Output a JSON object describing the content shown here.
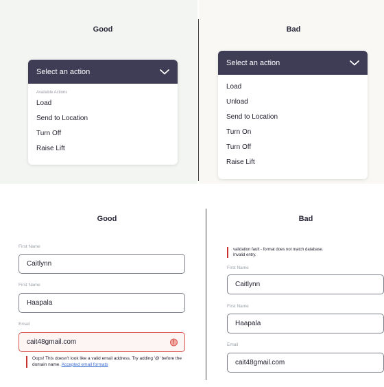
{
  "top": {
    "good": {
      "heading": "Good",
      "dropdown": {
        "header": "Select an action",
        "group_label": "Available Actions",
        "items": [
          "Load",
          "Send to Location",
          "Turn Off",
          "Raise Lift"
        ]
      }
    },
    "bad": {
      "heading": "Bad",
      "dropdown": {
        "header": "Select an action",
        "items": [
          "Load",
          "Unload",
          "Send to Location",
          "Turn On",
          "Turn Off",
          "Raise Lift"
        ]
      }
    }
  },
  "bottom": {
    "good": {
      "heading": "Good",
      "fields": [
        {
          "label": "First Name",
          "value": "Caitlynn"
        },
        {
          "label": "First Name",
          "value": "Haapala"
        },
        {
          "label": "Email",
          "value": "cait48gmail.com"
        }
      ],
      "error_icon": "!",
      "error_message": "Oops! This doesn't look like a valid email address. Try adding '@' before the domain name.",
      "error_link": "Accepted email formats"
    },
    "bad": {
      "heading": "Bad",
      "error_message_line1": "validation fault - format does not match database.",
      "error_message_line2": "Invalid entry.",
      "fields": [
        {
          "label": "First Name",
          "value": "Caitlynn"
        },
        {
          "label": "First Name",
          "value": "Haapala"
        },
        {
          "label": "Email",
          "value": "cait48gmail.com"
        }
      ]
    }
  },
  "colors": {
    "dropdown_header": "#3f3d56",
    "error": "#c9302c",
    "link": "#3b6fd6"
  }
}
